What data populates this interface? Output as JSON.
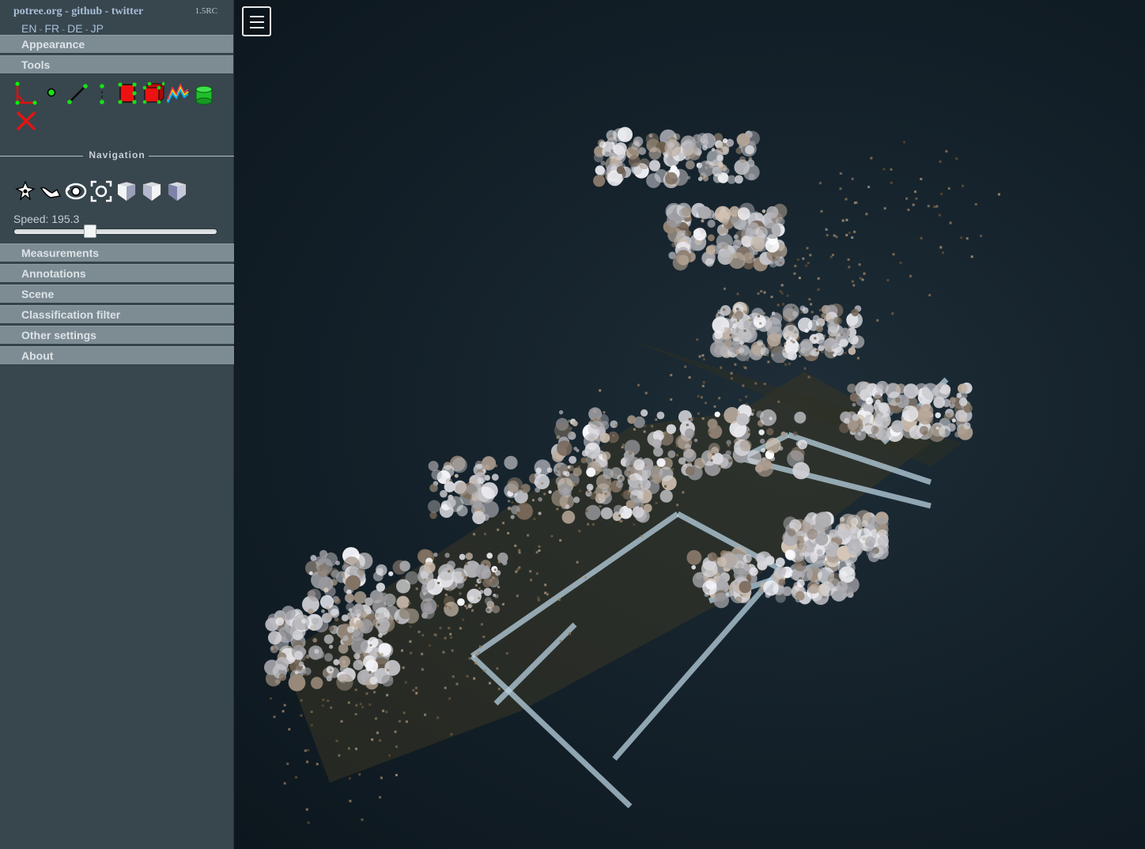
{
  "header": {
    "links": [
      "potree.org",
      "github",
      "twitter"
    ],
    "separator": "-",
    "version": "1.5RC",
    "languages": [
      "EN",
      "FR",
      "DE",
      "JP"
    ]
  },
  "sections": {
    "appearance": "Appearance",
    "tools": "Tools",
    "measurements": "Measurements",
    "annotations": "Annotations",
    "scene": "Scene",
    "classification": "Classification filter",
    "other": "Other settings",
    "about": "About"
  },
  "tools": {
    "icons": [
      "angle-icon",
      "point-icon",
      "distance-icon",
      "height-icon",
      "area-icon",
      "volume-icon",
      "profile-icon",
      "clip-volume-icon",
      "remove-all-icon"
    ]
  },
  "navigation": {
    "title": "Navigation",
    "icons": [
      "earth-controls-icon",
      "fly-controls-icon",
      "orbit-controls-icon",
      "focus-icon",
      "left-view-icon",
      "front-view-icon",
      "top-view-icon"
    ],
    "speed_label": "Speed: 195.3",
    "speed_fraction": 0.375
  },
  "viewer": {
    "background": "#15222b",
    "menu_icon": "hamburger-menu-icon"
  }
}
